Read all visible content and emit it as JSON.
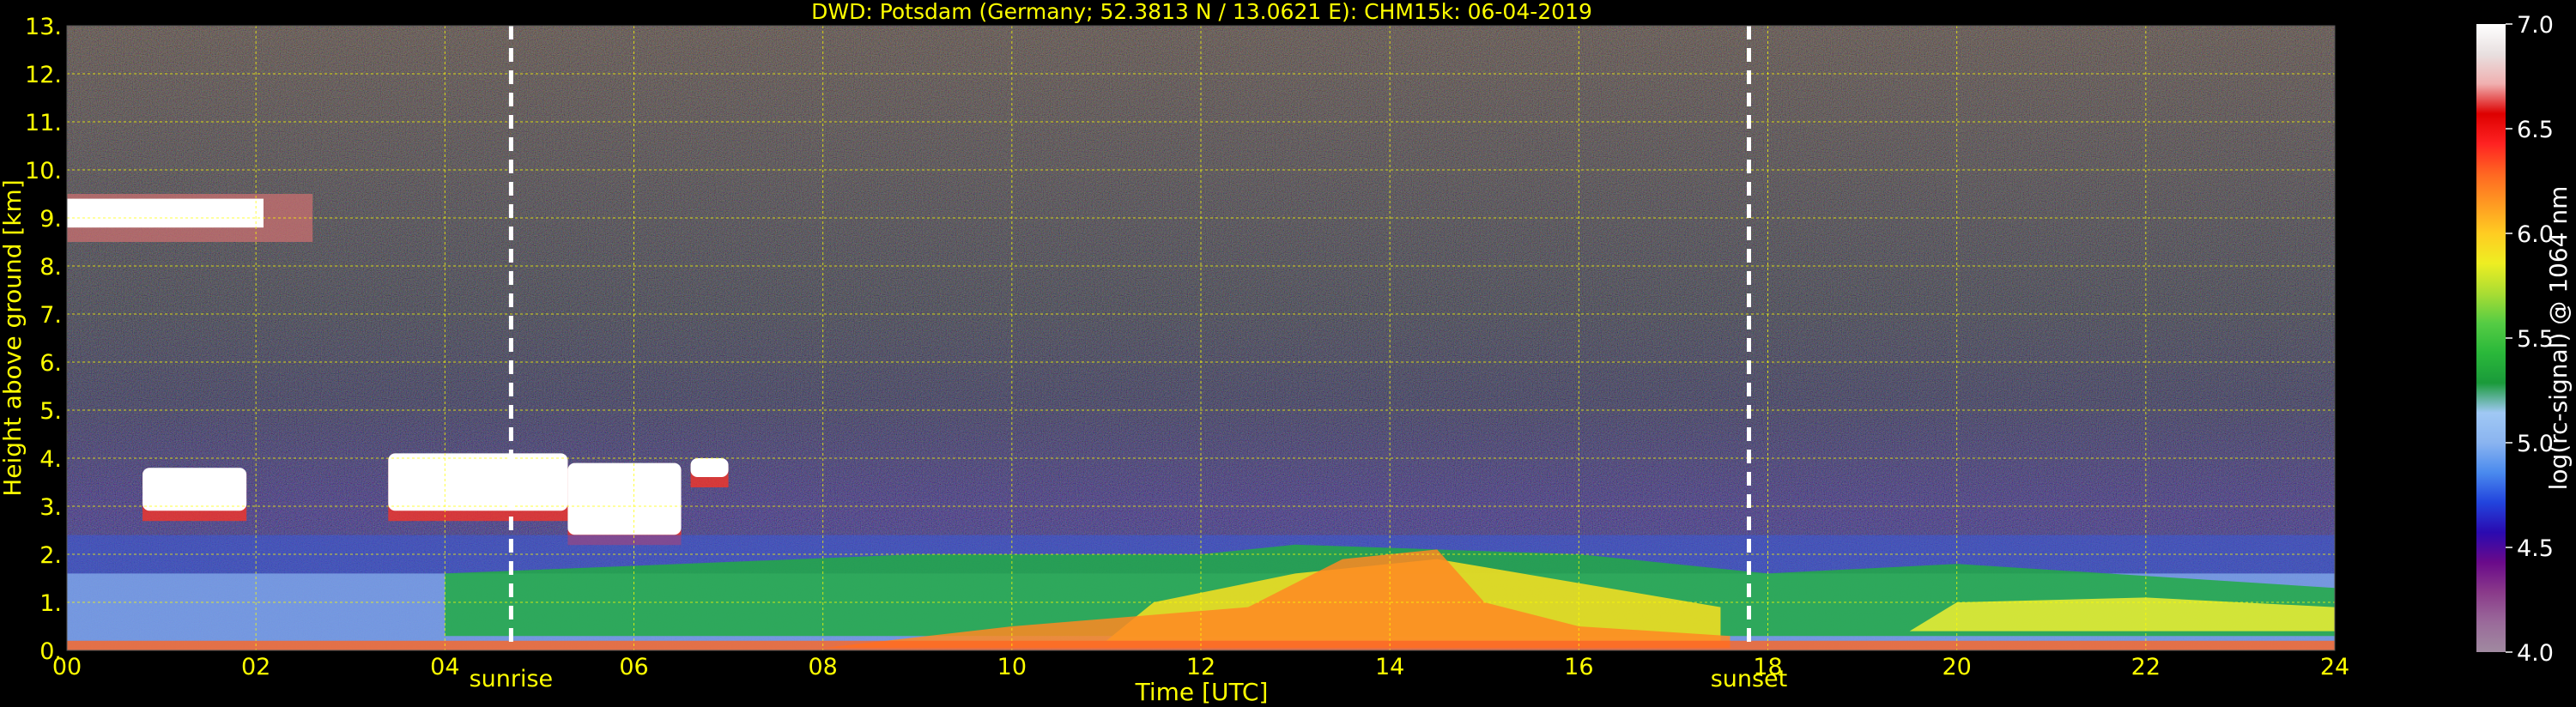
{
  "chart_data": {
    "type": "heatmap",
    "title": "DWD: Potsdam (Germany; 52.3813 N / 13.0621 E):    CHM15k: 06-04-2019",
    "xlabel": "Time [UTC]",
    "ylabel": "Height above ground [km]",
    "colorbar_label": "log(rc-signal) @ 1064 nm",
    "xlim": [
      0,
      24
    ],
    "ylim": [
      0,
      13
    ],
    "clim": [
      4.0,
      7.0
    ],
    "x_ticks": [
      "00",
      "02",
      "04",
      "06",
      "08",
      "10",
      "12",
      "14",
      "16",
      "18",
      "20",
      "22",
      "24"
    ],
    "x_tick_values": [
      0,
      2,
      4,
      6,
      8,
      10,
      12,
      14,
      16,
      18,
      20,
      22,
      24
    ],
    "y_ticks": [
      "0.",
      "1.",
      "2.",
      "3.",
      "4.",
      "5.",
      "6.",
      "7.",
      "8.",
      "9.",
      "10.",
      "11.",
      "12.",
      "13."
    ],
    "y_tick_values": [
      0,
      1,
      2,
      3,
      4,
      5,
      6,
      7,
      8,
      9,
      10,
      11,
      12,
      13
    ],
    "colorbar_ticks": [
      "4.0",
      "4.5",
      "5.0",
      "5.5",
      "6.0",
      "6.5",
      "7.0"
    ],
    "colorbar_tick_values": [
      4.0,
      4.5,
      5.0,
      5.5,
      6.0,
      6.5,
      7.0
    ],
    "grid": true,
    "colormap": [
      "#a08aa0",
      "#9a6a9a",
      "#8a3a8a",
      "#6a0a8a",
      "#2a0ab0",
      "#2244dd",
      "#4a8aee",
      "#8ab4f0",
      "#a0c8f4",
      "#1a9a3a",
      "#2ab83a",
      "#55cc44",
      "#aadd33",
      "#eeee22",
      "#ffcc22",
      "#ff9922",
      "#ff6622",
      "#ff2222",
      "#dd0000",
      "#f0b0b0",
      "#e8e0e0",
      "#ffffff"
    ],
    "events": [
      {
        "label": "sunrise",
        "time": 4.7
      },
      {
        "label": "sunset",
        "time": 17.8
      }
    ],
    "layers": [
      {
        "kind": "cirrus",
        "t0": 0.0,
        "t1": 2.6,
        "h0": 8.5,
        "h1": 9.5
      },
      {
        "kind": "cloud",
        "t0": 0.8,
        "t1": 1.9,
        "h0": 2.8,
        "h1": 3.8
      },
      {
        "kind": "cloud",
        "t0": 3.4,
        "t1": 5.3,
        "h0": 2.8,
        "h1": 4.1
      },
      {
        "kind": "cloud",
        "t0": 5.3,
        "t1": 6.5,
        "h0": 2.3,
        "h1": 3.9
      },
      {
        "kind": "cloud",
        "t0": 6.6,
        "t1": 7.0,
        "h0": 3.5,
        "h1": 4.0
      },
      {
        "kind": "boundary_layer",
        "t0": 0.0,
        "t1": 24.0,
        "h0": 0.0,
        "h1": 2.4
      }
    ],
    "colors": {
      "text": "#ffff00",
      "grid": "#ffff00",
      "background": "#000000",
      "event_line": "#ffffff"
    }
  }
}
